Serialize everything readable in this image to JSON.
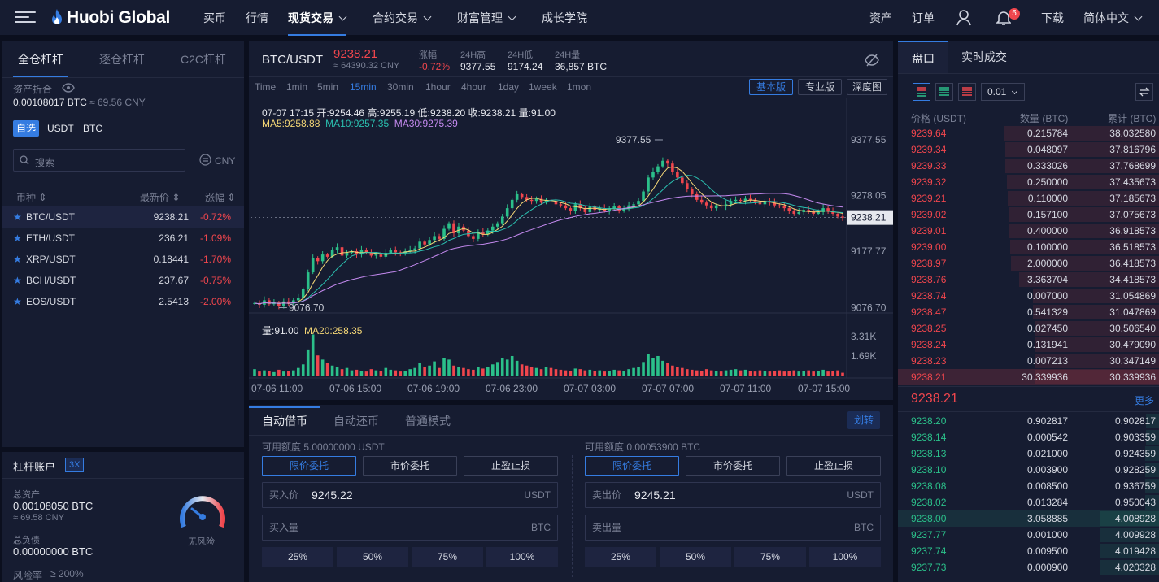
{
  "nav": {
    "logo": "Huobi Global",
    "items": [
      "买币",
      "行情",
      "现货交易",
      "合约交易",
      "财富管理",
      "成长学院"
    ],
    "right": [
      "资产",
      "订单",
      "下载",
      "简体中文"
    ],
    "notification_count": "5"
  },
  "left": {
    "tabs": [
      "全仓杠杆",
      "逐仓杠杆",
      "C2C杠杆"
    ],
    "asset_label": "资产折合",
    "asset_value": "0.00108017 BTC",
    "asset_cny": "≈ 69.56 CNY",
    "filters": [
      "自选",
      "USDT",
      "BTC"
    ],
    "search_placeholder": "搜索",
    "currency": "CNY",
    "headers": [
      "币种",
      "最新价",
      "涨幅"
    ],
    "markets": [
      {
        "sym": "BTC/USDT",
        "price": "9238.21",
        "change": "-0.72%"
      },
      {
        "sym": "ETH/USDT",
        "price": "236.21",
        "change": "-1.09%"
      },
      {
        "sym": "XRP/USDT",
        "price": "0.18441",
        "change": "-1.70%"
      },
      {
        "sym": "BCH/USDT",
        "price": "237.67",
        "change": "-0.75%"
      },
      {
        "sym": "EOS/USDT",
        "price": "2.5413",
        "change": "-2.00%"
      }
    ],
    "account_title": "杠杆账户",
    "leverage": "3X",
    "total_assets_label": "总资产",
    "total_assets": "0.00108050 BTC",
    "total_assets_cny": "≈ 69.58 CNY",
    "total_debt_label": "总负债",
    "total_debt": "0.00000000 BTC",
    "risk_label": "风险率",
    "risk_value": "≥ 200%",
    "gauge_label": "无风险"
  },
  "ticker": {
    "pair": "BTC/USDT",
    "price": "9238.21",
    "cny": "≈ 64390.32 CNY",
    "change_label": "涨幅",
    "change": "-0.72%",
    "high_label": "24H高",
    "high": "9377.55",
    "low_label": "24H低",
    "low": "9174.24",
    "vol_label": "24H量",
    "vol": "36,857 BTC"
  },
  "chart_toolbar": {
    "timeframes": [
      "Time",
      "1min",
      "5min",
      "15min",
      "30min",
      "1hour",
      "4hour",
      "1day",
      "1week",
      "1mon"
    ],
    "active": "15min",
    "views": [
      "基本版",
      "专业版",
      "深度图"
    ]
  },
  "chart_data": {
    "type": "candlestick",
    "info": "07-07 17:15  开:9254.46  高:9255.19  低:9238.20  收:9238.21  量:91.00",
    "ma": [
      "MA5:9258.88",
      "MA10:9257.35",
      "MA30:9275.39"
    ],
    "ma_colors": [
      "#f5d776",
      "#2bc0b0",
      "#c58af0"
    ],
    "y_ticks": [
      "9377.55",
      "9278.05",
      "9177.77",
      "9076.70"
    ],
    "y_range": [
      9060,
      9395
    ],
    "last_price": "9238.21",
    "high_mark": "9377.55",
    "low_mark": "9076.70",
    "volume_info": "量:91.00",
    "volume_ma": "MA20:258.35",
    "volume_ticks": [
      "3.31K",
      "1.69K"
    ],
    "x_ticks": [
      "07-06 11:00",
      "07-06 15:00",
      "07-06 19:00",
      "07-06 23:00",
      "07-07 03:00",
      "07-07 07:00",
      "07-07 11:00",
      "07-07 15:00"
    ],
    "closes": [
      9085,
      9082,
      9090,
      9083,
      9086,
      9080,
      9088,
      9084,
      9090,
      9095,
      9110,
      9140,
      9165,
      9160,
      9172,
      9168,
      9180,
      9185,
      9170,
      9175,
      9178,
      9172,
      9180,
      9176,
      9170,
      9172,
      9168,
      9175,
      9180,
      9176,
      9174,
      9178,
      9180,
      9183,
      9195,
      9190,
      9198,
      9205,
      9200,
      9218,
      9228,
      9210,
      9222,
      9215,
      9205,
      9200,
      9212,
      9208,
      9215,
      9222,
      9228,
      9240,
      9255,
      9270,
      9280,
      9275,
      9270,
      9268,
      9272,
      9265,
      9270,
      9268,
      9262,
      9260,
      9255,
      9250,
      9262,
      9255,
      9248,
      9258,
      9252,
      9255,
      9250,
      9255,
      9258,
      9250,
      9255,
      9260,
      9262,
      9268,
      9285,
      9310,
      9320,
      9330,
      9340,
      9335,
      9320,
      9310,
      9300,
      9290,
      9280,
      9270,
      9265,
      9260,
      9255,
      9260,
      9258,
      9262,
      9268,
      9270,
      9268,
      9272,
      9270,
      9266,
      9262,
      9268,
      9265,
      9260,
      9258,
      9255,
      9250,
      9245,
      9248,
      9252,
      9250,
      9245,
      9248,
      9255,
      9250,
      9245,
      9240,
      9238
    ],
    "volumes": [
      12,
      8,
      10,
      9,
      7,
      11,
      8,
      9,
      10,
      14,
      20,
      45,
      70,
      35,
      28,
      22,
      18,
      15,
      12,
      14,
      10,
      11,
      9,
      8,
      12,
      10,
      9,
      14,
      11,
      10,
      8,
      9,
      12,
      14,
      22,
      15,
      18,
      25,
      14,
      30,
      28,
      18,
      16,
      14,
      12,
      11,
      15,
      13,
      16,
      20,
      24,
      30,
      28,
      34,
      26,
      20,
      18,
      15,
      14,
      12,
      16,
      14,
      12,
      11,
      10,
      9,
      13,
      12,
      10,
      11,
      9,
      10,
      8,
      9,
      11,
      10,
      9,
      12,
      14,
      16,
      24,
      38,
      30,
      34,
      26,
      22,
      18,
      16,
      14,
      12,
      11,
      10,
      9,
      12,
      10,
      9,
      8,
      10,
      11,
      12,
      10,
      11,
      9,
      8,
      10,
      9,
      8,
      9,
      10,
      8,
      9,
      10,
      8,
      9,
      10,
      8,
      9,
      11,
      8,
      9,
      10,
      6
    ]
  },
  "trade": {
    "tabs": [
      "自动借币",
      "自动还币",
      "普通模式"
    ],
    "transfer": "划转",
    "buy": {
      "available": "可用额度  5.00000000 USDT",
      "types": [
        "限价委托",
        "市价委托",
        "止盈止损"
      ],
      "price_label": "买入价",
      "price": "9245.22",
      "price_unit": "USDT",
      "amount_label": "买入量",
      "amount_unit": "BTC"
    },
    "sell": {
      "available": "可用额度  0.00053900 BTC",
      "types": [
        "限价委托",
        "市价委托",
        "止盈止损"
      ],
      "price_label": "卖出价",
      "price": "9245.21",
      "price_unit": "USDT",
      "amount_label": "卖出量",
      "amount_unit": "BTC"
    },
    "percents": [
      "25%",
      "50%",
      "75%",
      "100%"
    ]
  },
  "book": {
    "tabs": [
      "盘口",
      "实时成交"
    ],
    "precision": "0.01",
    "headers": [
      "价格 (USDT)",
      "数量 (BTC)",
      "累计 (BTC)"
    ],
    "asks": [
      [
        "9239.64",
        "0.215784",
        "38.032580"
      ],
      [
        "9239.34",
        "0.048097",
        "37.816796"
      ],
      [
        "9239.33",
        "0.333026",
        "37.768699"
      ],
      [
        "9239.32",
        "0.250000",
        "37.435673"
      ],
      [
        "9239.21",
        "0.110000",
        "37.185673"
      ],
      [
        "9239.02",
        "0.157100",
        "37.075673"
      ],
      [
        "9239.01",
        "0.400000",
        "36.918573"
      ],
      [
        "9239.00",
        "0.100000",
        "36.518573"
      ],
      [
        "9238.97",
        "2.000000",
        "36.418573"
      ],
      [
        "9238.76",
        "3.363704",
        "34.418573"
      ],
      [
        "9238.74",
        "0.007000",
        "31.054869"
      ],
      [
        "9238.47",
        "0.541329",
        "31.047869"
      ],
      [
        "9238.25",
        "0.027450",
        "30.506540"
      ],
      [
        "9238.24",
        "0.131941",
        "30.479090"
      ],
      [
        "9238.23",
        "0.007213",
        "30.347149"
      ],
      [
        "9238.21",
        "30.339936",
        "30.339936"
      ]
    ],
    "last_price": "9238.21",
    "more": "更多",
    "bids": [
      [
        "9238.20",
        "0.902817",
        "0.902817"
      ],
      [
        "9238.14",
        "0.000542",
        "0.903359"
      ],
      [
        "9238.13",
        "0.021000",
        "0.924359"
      ],
      [
        "9238.10",
        "0.003900",
        "0.928259"
      ],
      [
        "9238.08",
        "0.008500",
        "0.936759"
      ],
      [
        "9238.02",
        "0.013284",
        "0.950043"
      ],
      [
        "9238.00",
        "3.058885",
        "4.008928"
      ],
      [
        "9237.77",
        "0.001000",
        "4.009928"
      ],
      [
        "9237.74",
        "0.009500",
        "4.019428"
      ],
      [
        "9237.73",
        "0.000900",
        "4.020328"
      ]
    ]
  }
}
